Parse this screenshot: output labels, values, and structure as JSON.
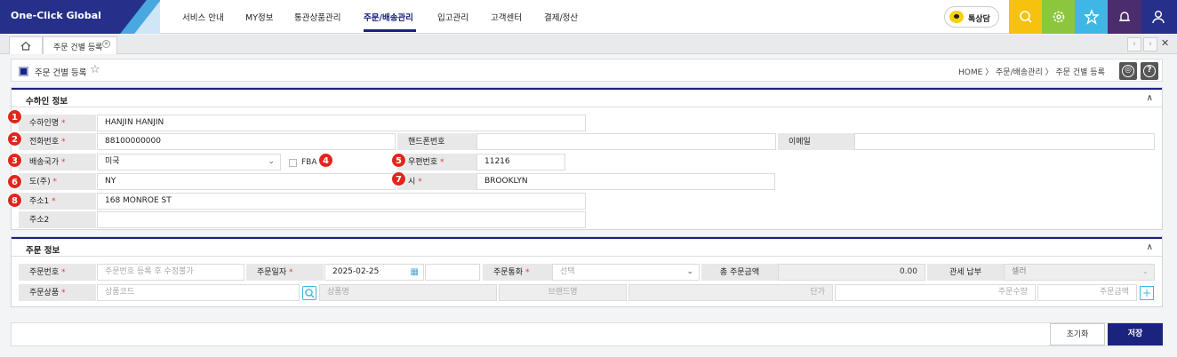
{
  "app": {
    "logo": "One-Click Global"
  },
  "nav": [
    "서비스 안내",
    "MY정보",
    "통관상품관리",
    "주문/배송관리",
    "입고관리",
    "고객센터",
    "결제/정산"
  ],
  "kakao_label": "톡상담",
  "top_icons": [
    "search-icon",
    "gear-icon",
    "star-icon",
    "bell-icon",
    "user-icon"
  ],
  "colors": {
    "brand": "#26308a",
    "yellow": "#f6c20d",
    "green": "#8cc63f",
    "cyan": "#3fb7e4",
    "purple": "#4b2d6e",
    "navy": "#1a237e",
    "required": "#e53935",
    "badge": "#e0261c"
  },
  "tabs": {
    "home_icon": "home-icon",
    "active": "주문 건별 등록",
    "close": "✕"
  },
  "page": {
    "title": "주문 건별 등록",
    "breadcrumb": "HOME 〉 주문/배송관리 〉 주문 건별 등록"
  },
  "receiver": {
    "title": "수하인 정보",
    "fields": {
      "name": {
        "label": "수하인명",
        "value": "HANJIN HANJIN"
      },
      "phone": {
        "label": "전화번호",
        "value": "88100000000"
      },
      "mobile": {
        "label": "핸드폰번호",
        "value": ""
      },
      "email": {
        "label": "이메일",
        "value": ""
      },
      "country": {
        "label": "배송국가",
        "value": "미국"
      },
      "fba": {
        "label": "FBA"
      },
      "zip": {
        "label": "우편번호",
        "value": "11216"
      },
      "state": {
        "label": "도(주)",
        "value": "NY"
      },
      "city": {
        "label": "시",
        "value": "BROOKLYN"
      },
      "addr1": {
        "label": "주소1",
        "value": "168 MONROE ST"
      },
      "addr2": {
        "label": "주소2",
        "value": ""
      }
    },
    "required_mark": "*"
  },
  "badges": [
    "1",
    "2",
    "3",
    "4",
    "5",
    "6",
    "7",
    "8"
  ],
  "order": {
    "title": "주문 정보",
    "order_no": {
      "label": "주문번호",
      "placeholder": "주문번호 등록 후 수정불가"
    },
    "order_date": {
      "label": "주문일자",
      "value": "2025-02-25"
    },
    "currency": {
      "label": "주문통화",
      "placeholder": "선택"
    },
    "total": {
      "label": "총 주문금액",
      "value": "0.00"
    },
    "duty": {
      "label": "관세 납부",
      "value": "셀러"
    },
    "product": {
      "label": "주문상품",
      "code_ph": "상품코드",
      "name_ph": "상품명",
      "brand_ph": "브랜드명",
      "price_ph": "단가",
      "qty_ph": "주문수량",
      "amount_ph": "주문금액",
      "add": "+"
    }
  },
  "buttons": {
    "reset": "초기화",
    "save": "저장"
  }
}
